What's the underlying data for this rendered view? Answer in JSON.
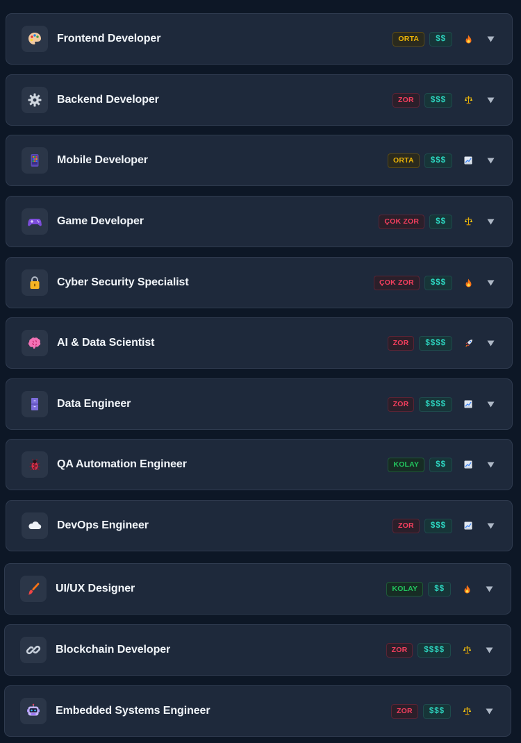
{
  "careers": [
    {
      "title": "Frontend Developer",
      "icon": "palette-icon",
      "difficulty": "ORTA",
      "difficulty_level": "orta",
      "salary": "$$",
      "trend": "fire-icon"
    },
    {
      "title": "Backend Developer",
      "icon": "gear-icon",
      "difficulty": "ZOR",
      "difficulty_level": "zor",
      "salary": "$$$",
      "trend": "scales-icon"
    },
    {
      "title": "Mobile Developer",
      "icon": "phone-icon",
      "difficulty": "ORTA",
      "difficulty_level": "orta",
      "salary": "$$$",
      "trend": "chart-up-icon"
    },
    {
      "title": "Game Developer",
      "icon": "gamepad-icon",
      "difficulty": "ÇOK ZOR",
      "difficulty_level": "cokzor",
      "salary": "$$",
      "trend": "scales-icon"
    },
    {
      "title": "Cyber Security Specialist",
      "icon": "lock-icon",
      "difficulty": "ÇOK ZOR",
      "difficulty_level": "cokzor",
      "salary": "$$$",
      "trend": "fire-icon"
    },
    {
      "title": "AI & Data Scientist",
      "icon": "brain-icon",
      "difficulty": "ZOR",
      "difficulty_level": "zor",
      "salary": "$$$$",
      "trend": "rocket-icon"
    },
    {
      "title": "Data Engineer",
      "icon": "filing-cabinet-icon",
      "difficulty": "ZOR",
      "difficulty_level": "zor",
      "salary": "$$$$",
      "trend": "chart-up-icon"
    },
    {
      "title": "QA Automation Engineer",
      "icon": "bug-icon",
      "difficulty": "KOLAY",
      "difficulty_level": "kolay",
      "salary": "$$",
      "trend": "chart-up-icon"
    },
    {
      "title": "DevOps Engineer",
      "icon": "cloud-icon",
      "difficulty": "ZOR",
      "difficulty_level": "zor",
      "salary": "$$$",
      "trend": "chart-up-icon"
    },
    {
      "title": "UI/UX Designer",
      "icon": "paintbrush-icon",
      "difficulty": "KOLAY",
      "difficulty_level": "kolay",
      "salary": "$$",
      "trend": "fire-icon"
    },
    {
      "title": "Blockchain Developer",
      "icon": "link-icon",
      "difficulty": "ZOR",
      "difficulty_level": "zor",
      "salary": "$$$$",
      "trend": "scales-icon"
    },
    {
      "title": "Embedded Systems Engineer",
      "icon": "robot-icon",
      "difficulty": "ZOR",
      "difficulty_level": "zor",
      "salary": "$$$",
      "trend": "scales-icon"
    }
  ],
  "colors": {
    "background": "#0d1726",
    "card": "#1e293b",
    "orta": "#eab308",
    "zor": "#f43f5e",
    "kolay": "#22c55e",
    "salary": "#2dd4bf"
  }
}
